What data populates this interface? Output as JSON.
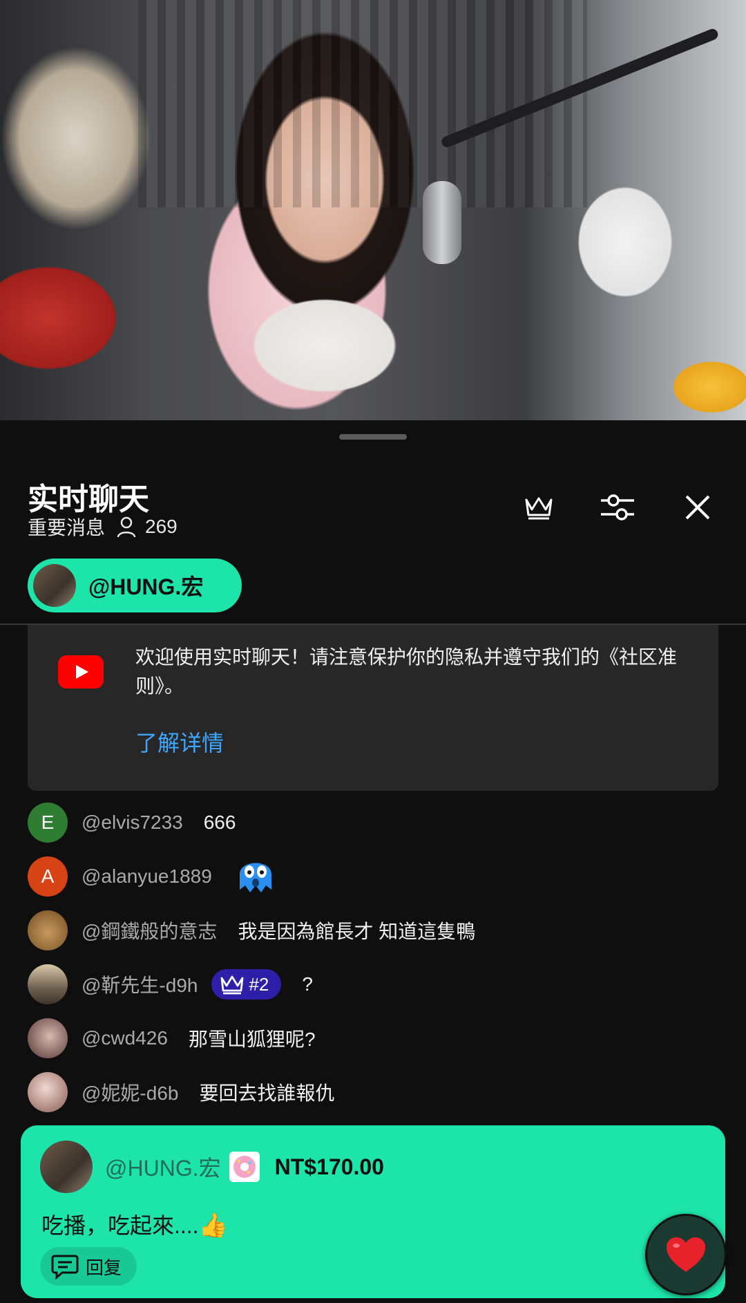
{
  "video": {
    "description_icon": "live-video-frame"
  },
  "chat": {
    "title": "实时聊天",
    "mode_label": "重要消息",
    "viewer_count": "269",
    "pinned_chip_label": "@HUNG.宏",
    "welcome": {
      "text": "欢迎使用实时聊天！请注意保护你的隐私并遵守我们的《社区准则》。",
      "link": "了解详情"
    },
    "messages": [
      {
        "avatar_letter": "E",
        "avatar_color": "#2e7d32",
        "author": "@elvis7233",
        "text": "666"
      },
      {
        "avatar_letter": "A",
        "avatar_color": "#d84315",
        "author": "@alanyue1889",
        "text": ""
      },
      {
        "avatar_letter": "",
        "avatar_color": "#b98a4e",
        "author": "@鋼鐵般的意志",
        "text": "我是因為館長才 知道這隻鴨"
      },
      {
        "avatar_letter": "",
        "avatar_color": "#8b6e4a",
        "author": "@靳先生-d9h",
        "badge": "#2",
        "text": "?"
      },
      {
        "avatar_letter": "",
        "avatar_color": "#9a7c78",
        "author": "@cwd426",
        "text": "那雪山狐狸呢?"
      },
      {
        "avatar_letter": "",
        "avatar_color": "#c9a9a2",
        "author": "@妮妮-d6b",
        "text": "要回去找誰報仇"
      }
    ],
    "superchat": {
      "author": "@HUNG.宏",
      "amount": "NT$170.00",
      "text": "吃播，吃起來....",
      "reply_label": "回复"
    }
  },
  "colors": {
    "accent": "#1de5a9",
    "link": "#3ea6ff",
    "badge": "#2e1fa8",
    "youtube_red": "#ff0000"
  }
}
